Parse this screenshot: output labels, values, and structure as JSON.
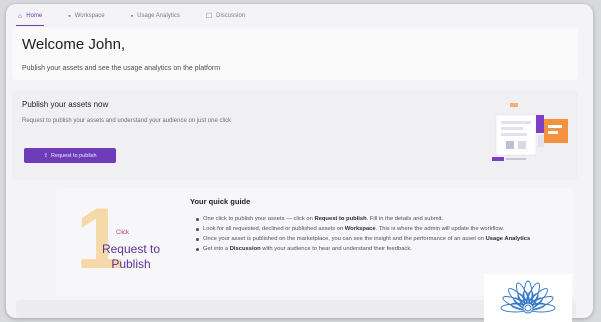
{
  "tabs": [
    {
      "icon": "home-icon",
      "glyph": "⌂",
      "label": "Home",
      "active": true
    },
    {
      "icon": "workspace-icon",
      "glyph": "▪",
      "label": "Workspace",
      "active": false
    },
    {
      "icon": "analytics-icon",
      "glyph": "▪",
      "label": "Usage Analytics",
      "active": false
    },
    {
      "icon": "discussion-icon",
      "glyph": "☐",
      "label": "Discussion",
      "active": false
    }
  ],
  "welcome": {
    "title": "Welcome John,",
    "subtitle": "Publish your assets and see the usage analytics on the platform"
  },
  "publish": {
    "title": "Publish your assets now",
    "description": "Request to publish your assets and understand your audience on just one click",
    "button_label": "Request to publish",
    "button_icon": "publish-icon"
  },
  "guide": {
    "step_number": "1",
    "step_action": "Click",
    "step_line1": "Request to",
    "step_line2": "Publish",
    "title": "Your quick guide",
    "items": [
      {
        "before": "One click to publish your assets — click on ",
        "bold": "Request to publish",
        "after": ". Fill in the details and submit."
      },
      {
        "before": "Look for all requested, declined or published assets on ",
        "bold": "Workspace",
        "after": ". This is where the admin will update the workflow."
      },
      {
        "before": "Once your asset is published on the marketplace, you can see the insight and the performance of an asset on ",
        "bold": "Usage Analytics",
        "after": ""
      },
      {
        "before": "Get into a ",
        "bold": "Discussion",
        "after": " with your audience to hear and understand their feedback."
      }
    ]
  },
  "colors": {
    "accent": "#6e3cb8",
    "step_accent": "#c93a63",
    "number_fill": "#f5d9a8"
  }
}
